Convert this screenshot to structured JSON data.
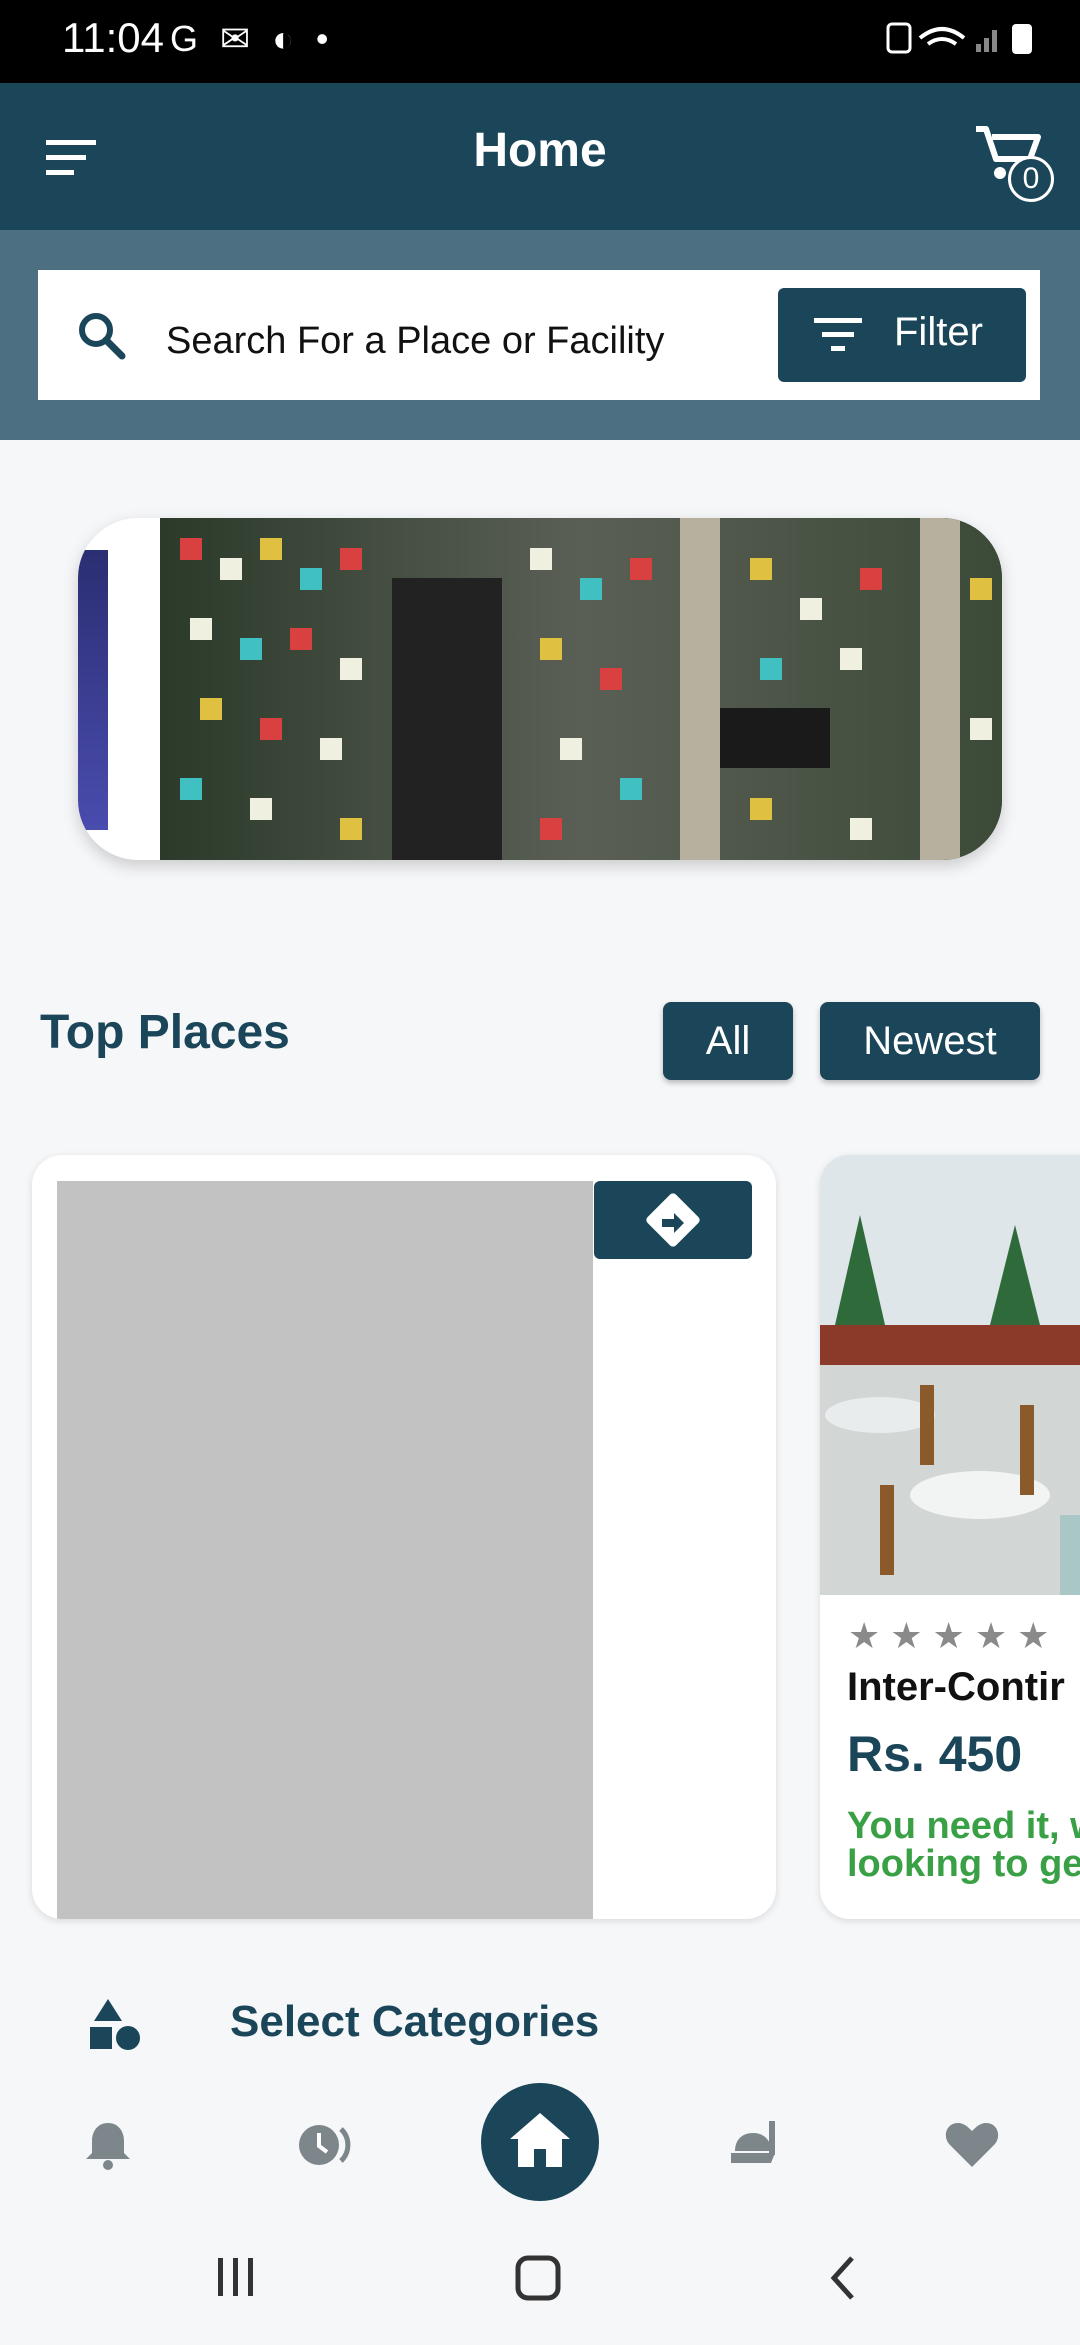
{
  "status_bar": {
    "time": "11:04",
    "left_icons": "G ✉ ◐ •",
    "right_icons": "🔋"
  },
  "app_bar": {
    "title": "Home",
    "cart_count": "0",
    "menu_icon": "menu-icon",
    "cart_icon": "shopping-cart-icon"
  },
  "search": {
    "placeholder": "Search For a Place or Facility",
    "filter_label": "Filter"
  },
  "top_places": {
    "title": "Top Places",
    "chips": [
      "All",
      "Newest"
    ],
    "cards": [
      {
        "image": "placeholder-gray",
        "action_icon": "directions-icon"
      },
      {
        "image": "restaurant-interior",
        "rating_stars": "★★★★★",
        "name": "Inter-Contir",
        "price": "Rs. 450",
        "description_line1": "You need it, w",
        "description_line2": "looking to get"
      }
    ]
  },
  "categories": {
    "label": "Select Categories",
    "icon": "shapes-icon"
  },
  "bottom_nav": {
    "items": [
      "bell-icon",
      "history-icon",
      "home-icon",
      "food-icon",
      "heart-icon"
    ]
  },
  "colors": {
    "primary": "#1b4659",
    "search_band": "#4c7082",
    "accent_green": "#3aa046",
    "placeholder_gray": "#c2c2c2"
  }
}
